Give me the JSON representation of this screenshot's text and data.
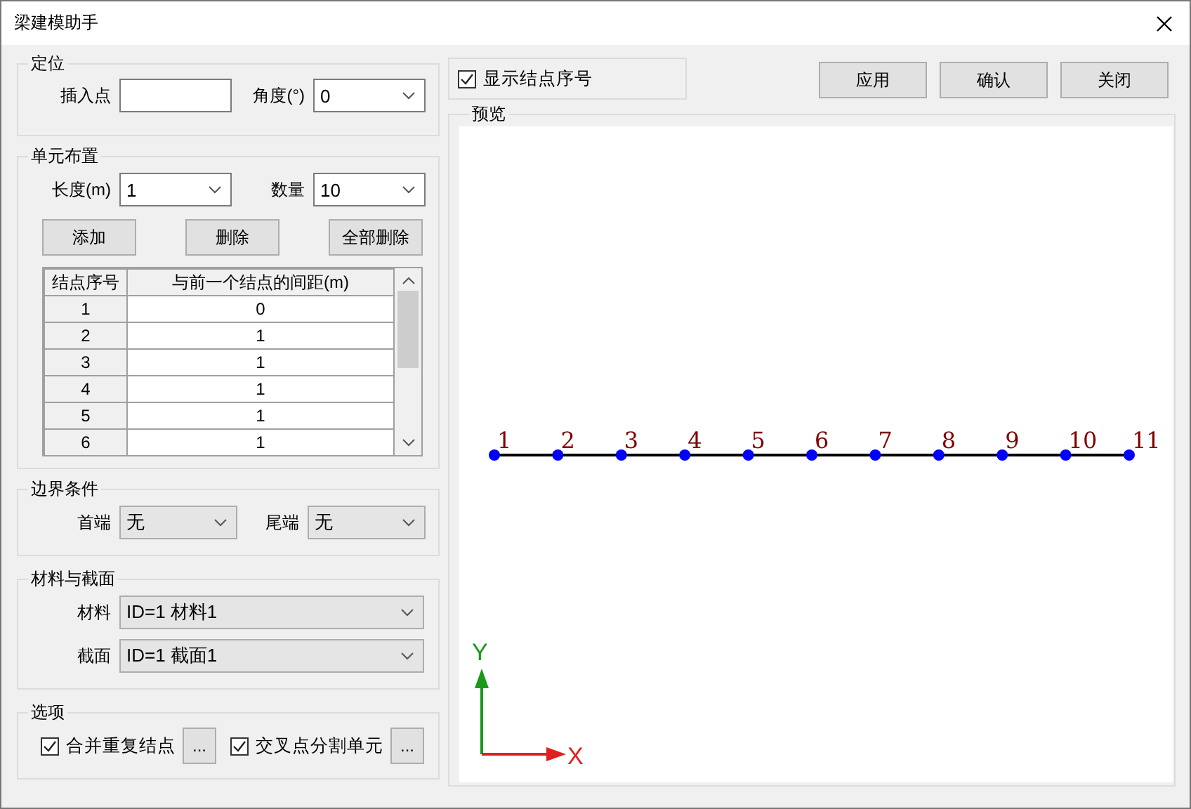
{
  "window": {
    "title": "梁建模助手"
  },
  "locate": {
    "title": "定位",
    "insert_point": {
      "label": "插入点"
    },
    "angle": {
      "label": "角度(°)",
      "value": "0",
      "editable": true
    }
  },
  "layout": {
    "title": "单元布置",
    "length": {
      "label": "长度(m)",
      "value": "1",
      "editable": true
    },
    "count": {
      "label": "数量",
      "value": "10",
      "editable": true
    },
    "buttons": [
      "添加",
      "删除",
      "全部删除"
    ],
    "table": {
      "columns": [
        "结点序号",
        "与前一个结点的间距(m)"
      ],
      "rows": [
        [
          "1",
          "0"
        ],
        [
          "2",
          "1"
        ],
        [
          "3",
          "1"
        ],
        [
          "4",
          "1"
        ],
        [
          "5",
          "1"
        ],
        [
          "6",
          "1"
        ]
      ]
    }
  },
  "boundary": {
    "title": "边界条件",
    "start": {
      "label": "首端",
      "value": "无",
      "editable": false
    },
    "end": {
      "label": "尾端",
      "value": "无",
      "editable": false
    }
  },
  "material": {
    "title": "材料与截面",
    "material": {
      "label": "材料",
      "value": "ID=1  材料1",
      "editable": false
    },
    "section": {
      "label": "截面",
      "value": "ID=1  截面1",
      "editable": false
    }
  },
  "options": {
    "title": "选项",
    "items": [
      {
        "label": "合并重复结点",
        "checked": true,
        "more": "..."
      },
      {
        "label": "交叉点分割单元",
        "checked": true,
        "more": "..."
      }
    ]
  },
  "show_numbers": {
    "label": "显示结点序号",
    "checked": true
  },
  "actions": [
    "应用",
    "确认",
    "关闭"
  ],
  "preview": {
    "title": "预览",
    "nodes": [
      "1",
      "2",
      "3",
      "4",
      "5",
      "6",
      "7",
      "8",
      "9",
      "10",
      "11"
    ],
    "x_label": "X",
    "y_label": "Y"
  }
}
